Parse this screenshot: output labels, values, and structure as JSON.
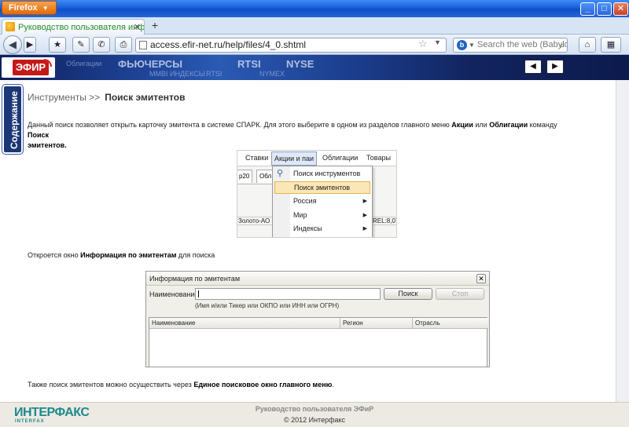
{
  "browser": {
    "app_button": "Firefox",
    "tab_title": "Руководство пользователя информ...",
    "new_tab": "+",
    "url": "access.efir-net.ru/help/files/4_0.shtml",
    "search_placeholder": "Search the web (Babylon)",
    "window_buttons": {
      "minimize": "_",
      "maximize": "□",
      "close": "✕"
    }
  },
  "banner": {
    "logo_text": "ЭФИР",
    "tickers": [
      "Облигации",
      "ФЬЮЧЕРСЫ",
      "RTSI",
      "NYSE",
      "ИНДЕКСЫ",
      "NYMEX",
      "MMBI",
      "RTSI"
    ],
    "prev": "◀",
    "next": "▶"
  },
  "sidebar": {
    "label": "Содержание"
  },
  "breadcrumb": {
    "parent": "Инструменты >>",
    "current": "Поиск эмитентов"
  },
  "intro": {
    "p1": "Данный поиск позволяет открыть карточку эмитента в системе СПАРК. Для этого выберите в одном из  разделов главного меню ",
    "b1": "Акции",
    "p2": " или ",
    "b2": "Облигации",
    "p3": " команду ",
    "b3": "Поиск",
    "b4": "эмитентов."
  },
  "menu_shot": {
    "menubar": [
      "Ставки",
      "Акции и паи",
      "Облигации",
      "Товары"
    ],
    "tab1": "р20",
    "tab2": "Обл",
    "row_left": "Золото-АО",
    "row_right": "REL:8,07",
    "items": [
      {
        "label": "Поиск инструментов",
        "sub": ""
      },
      {
        "label": "Поиск эмитентов",
        "sub": ""
      },
      {
        "label": "Россия",
        "sub": "▶"
      },
      {
        "label": "Мир",
        "sub": "▶"
      },
      {
        "label": "Индексы",
        "sub": "▶"
      }
    ]
  },
  "para2": {
    "p1": "Откроется окно ",
    "b1": "Информация по эмитентам",
    "p2": " для поиска"
  },
  "dialog": {
    "title": "Информация по эмитентам",
    "close": "✕",
    "label": "Наименование",
    "search_btn": "Поиск",
    "stop_btn": "Стоп",
    "hint": "(Имя и/или Тикер или ОКПО или ИНН или ОГРН)",
    "columns": [
      "Наименование",
      "Регион",
      "Отрасль"
    ]
  },
  "para3": {
    "p1": "Также поиск эмитентов можно осуществить через ",
    "b1": "Единое поисковое окно главного меню",
    "p2": "."
  },
  "footer": {
    "logo": "ИНТЕРФАКС",
    "logo_sub": "INTERFAX",
    "title": "Руководство пользователя ЭФиР",
    "copyright": "© 2012  Интерфакс"
  },
  "colors": {
    "banner_dark": "#0f1f5a",
    "efir_red": "#c41a1a",
    "interfax_teal": "#1d8a8d",
    "sidebar_blue": "#1c3776"
  }
}
